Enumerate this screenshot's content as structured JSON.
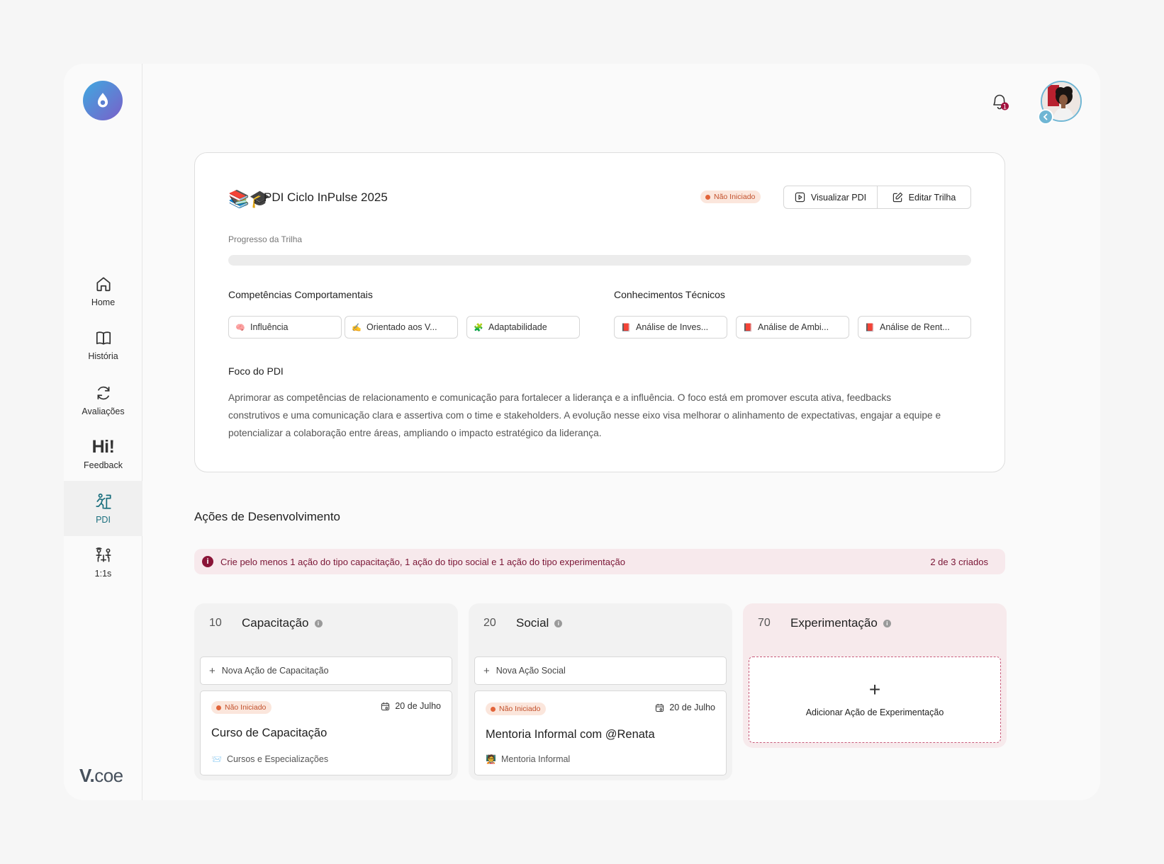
{
  "sidebar": {
    "items": [
      {
        "label": "Home"
      },
      {
        "label": "História"
      },
      {
        "label": "Avaliações"
      },
      {
        "label": "Feedback",
        "glyph": "Hi!"
      },
      {
        "label": "PDI"
      },
      {
        "label": "1:1s"
      }
    ],
    "active": "PDI",
    "brand": {
      "prefix": "V.",
      "suffix": "coe"
    }
  },
  "header": {
    "notification_count": "1"
  },
  "pdi": {
    "title": "PDI Ciclo InPulse 2025",
    "status": "Não Iniciado",
    "buttons": {
      "view": "Visualizar PDI",
      "edit": "Editar Trilha"
    },
    "progress_label": "Progresso da Trilha",
    "progress_fraction": 0,
    "behavioral": {
      "title": "Competências Comportamentais",
      "chips": [
        {
          "label": "Influência",
          "icon": "🧠"
        },
        {
          "label": "Orientado aos V...",
          "icon": "✍️"
        },
        {
          "label": "Adaptabilidade",
          "icon": "🧩"
        }
      ]
    },
    "technical": {
      "title": "Conhecimentos Técnicos",
      "chips": [
        {
          "label": "Análise de Inves...",
          "icon": "📕"
        },
        {
          "label": "Análise de Ambi...",
          "icon": "📕"
        },
        {
          "label": "Análise de Rent...",
          "icon": "📕"
        }
      ]
    },
    "focus_title": "Foco do PDI",
    "focus_text": "Aprimorar as competências de relacionamento e comunicação para fortalecer a liderança e a influência. O foco está em promover escuta ativa, feedbacks construtivos e uma comunicação clara e assertiva com o time e stakeholders. A evolução nesse eixo visa melhorar o alinhamento de expectativas, engajar a equipe e potencializar a colaboração entre áreas, ampliando o impacto estratégico da liderança."
  },
  "actions": {
    "title": "Ações de Desenvolvimento",
    "alert_text": "Crie pelo menos 1 ação do tipo capacitação, 1 ação do tipo social e 1 ação do tipo experimentação",
    "alert_count": "2 de 3 criados",
    "columns": [
      {
        "num": "10",
        "title": "Capacitação",
        "new_label": "Nova Ação de Capacitação",
        "card": {
          "status": "Não Iniciado",
          "date": "20 de Julho",
          "title": "Curso de Capacitação",
          "type": "Cursos e Especializações",
          "type_icon": "📨"
        }
      },
      {
        "num": "20",
        "title": "Social",
        "new_label": "Nova Ação Social",
        "card": {
          "status": "Não Iniciado",
          "date": "20 de Julho",
          "title": "Mentoria Informal com @Renata",
          "type": "Mentoria Informal",
          "type_icon": "🧑‍🏫"
        }
      },
      {
        "num": "70",
        "title": "Experimentação",
        "add_label": "Adicionar Ação de Experimentação"
      }
    ]
  },
  "colors": {
    "accent": "#2a8ca0",
    "alert_bg": "#f7e9ec",
    "alert_text": "#7a1535",
    "badge_bg": "#fbe6dc",
    "badge_dot": "#e2643a"
  }
}
